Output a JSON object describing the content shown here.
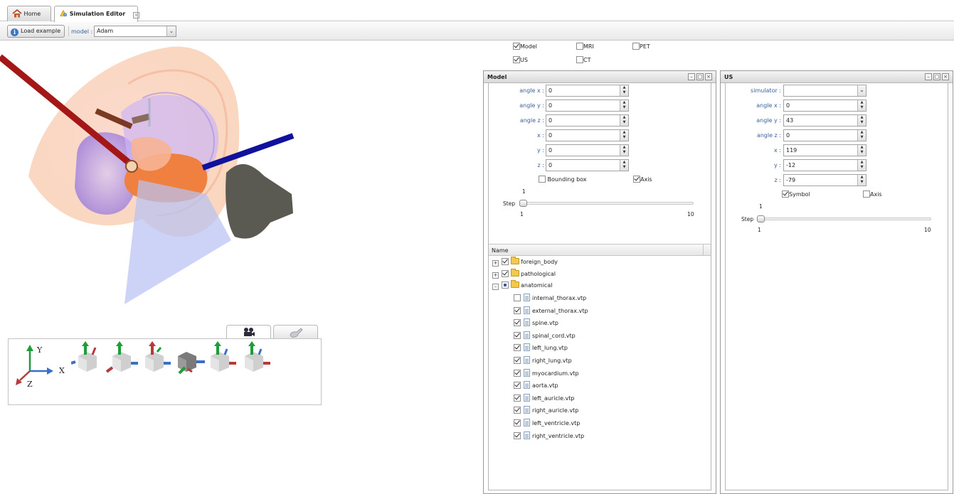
{
  "tabs": [
    {
      "label": "Home",
      "icon": "home-icon"
    },
    {
      "label": "Simulation Editor",
      "icon": "simulation-icon",
      "active": true
    }
  ],
  "toolbar": {
    "load_example_label": "Load example",
    "model_label": "model",
    "model_separator": ":",
    "model_value": "Adam"
  },
  "view_axes": {
    "x": "X",
    "y": "Y",
    "z": "Z"
  },
  "view_tabs": [
    "camera-icon",
    "probe-icon"
  ],
  "layers": [
    {
      "label": "Model",
      "checked": true
    },
    {
      "label": "MRI",
      "checked": false
    },
    {
      "label": "PET",
      "checked": false
    },
    {
      "label": "US",
      "checked": true
    },
    {
      "label": "CT",
      "checked": false
    }
  ],
  "model_panel": {
    "title": "Model",
    "fields": [
      {
        "label": "angle x",
        "value": "0"
      },
      {
        "label": "angle y",
        "value": "0"
      },
      {
        "label": "angle z",
        "value": "0"
      },
      {
        "label": "x",
        "value": "0"
      },
      {
        "label": "y",
        "value": "0"
      },
      {
        "label": "z",
        "value": "0"
      }
    ],
    "colon": ":",
    "bounding_box": {
      "label": "Bounding box",
      "checked": false
    },
    "axis": {
      "label": "Axis",
      "checked": true
    },
    "step": {
      "label": "Step",
      "current": "1",
      "min": "1",
      "max": "10",
      "value": 1
    },
    "tree": {
      "column": "Name",
      "groups": [
        {
          "label": "foreign_body",
          "checked": true,
          "expanded": false
        },
        {
          "label": "pathological",
          "checked": true,
          "expanded": false
        },
        {
          "label": "anatomical",
          "checked": "partial",
          "expanded": true
        }
      ],
      "files": [
        {
          "label": "internal_thorax.vtp",
          "checked": false
        },
        {
          "label": "external_thorax.vtp",
          "checked": true
        },
        {
          "label": "spine.vtp",
          "checked": true
        },
        {
          "label": "spinal_cord.vtp",
          "checked": true
        },
        {
          "label": "left_lung.vtp",
          "checked": true
        },
        {
          "label": "right_lung.vtp",
          "checked": true
        },
        {
          "label": "myocardium.vtp",
          "checked": true
        },
        {
          "label": "aorta.vtp",
          "checked": true
        },
        {
          "label": "left_auricle.vtp",
          "checked": true
        },
        {
          "label": "right_auricle.vtp",
          "checked": true
        },
        {
          "label": "left_ventricle.vtp",
          "checked": true
        },
        {
          "label": "right_ventricle.vtp",
          "checked": true
        }
      ]
    }
  },
  "us_panel": {
    "title": "US",
    "simulator": {
      "label": "simulator",
      "value": ""
    },
    "fields": [
      {
        "label": "angle x",
        "value": "0"
      },
      {
        "label": "angle y",
        "value": "43"
      },
      {
        "label": "angle z",
        "value": "0"
      },
      {
        "label": "x",
        "value": "119"
      },
      {
        "label": "y",
        "value": "-12"
      },
      {
        "label": "z",
        "value": "-79"
      }
    ],
    "colon": ":",
    "symbol": {
      "label": "Symbol",
      "checked": true
    },
    "axis": {
      "label": "Axis",
      "checked": false
    },
    "step": {
      "label": "Step",
      "current": "1",
      "min": "1",
      "max": "10",
      "value": 1
    }
  },
  "window_controls": {
    "minimize": "–",
    "maximize": "□",
    "close": "×"
  }
}
